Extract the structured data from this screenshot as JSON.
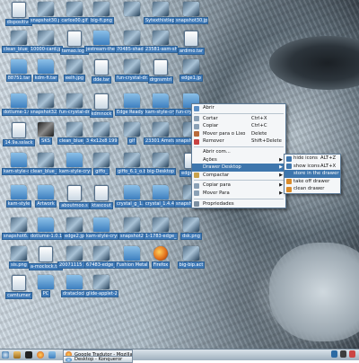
{
  "colors": {
    "selection": "#3e76ad",
    "icon_label_bg": "#3f7ab8",
    "menu_bg": "#f4f6f8"
  },
  "desktop_icons": [
    {
      "label": "dispositivo",
      "kind": "doc"
    },
    {
      "label": "snapshot30.png",
      "kind": "img"
    },
    {
      "label": "carlos00.gif",
      "kind": "img"
    },
    {
      "label": "big-fi.png",
      "kind": "img"
    },
    {
      "label": "",
      "kind": "img"
    },
    {
      "label": "Sytexthistlepor",
      "kind": "img"
    },
    {
      "label": "snapshot30.jpg",
      "kind": "img"
    },
    {
      "label": "clean_blue_1024x768",
      "kind": "img"
    },
    {
      "label": "10000-card.jpg",
      "kind": "img"
    },
    {
      "label": "tamao.log4",
      "kind": "doc"
    },
    {
      "label": "jestream-theme.tar",
      "kind": "folder"
    },
    {
      "label": "70485-shadow.jpg",
      "kind": "img"
    },
    {
      "label": "23581-asm-shadow.jpg",
      "kind": "img"
    },
    {
      "label": "ardimo.tar",
      "kind": "doc"
    },
    {
      "label": "88751.tar",
      "kind": "folder"
    },
    {
      "label": "kdm-fi.tar",
      "kind": "folder"
    },
    {
      "label": "eelh.jpg",
      "kind": "img"
    },
    {
      "label": "dde.tar",
      "kind": "doc"
    },
    {
      "label": "fun-crystal-dr.png",
      "kind": "img"
    },
    {
      "label": "drgnsmtrl",
      "kind": "doc"
    },
    {
      "label": "edge1.jp",
      "kind": "img"
    },
    {
      "label": "dotlume-1.0.1",
      "kind": "folder"
    },
    {
      "label": "snapshot32.png",
      "kind": "img"
    },
    {
      "label": "fun-crystal-dr.png",
      "kind": "img"
    },
    {
      "label": "kdmnock",
      "kind": "doc"
    },
    {
      "label": "Edge Ready Hu-tar",
      "kind": "folder"
    },
    {
      "label": "kam-style-crystal-1.0",
      "kind": "folder"
    },
    {
      "label": "fun-crystal-fa.tar",
      "kind": "folder"
    },
    {
      "label": "14.9a.sslack",
      "kind": "doc"
    },
    {
      "label": "SKS",
      "kind": "cat"
    },
    {
      "label": "clean_blue_1024x768",
      "kind": "img"
    },
    {
      "label": "3 4x12x8 1993",
      "kind": "img"
    },
    {
      "label": "gif",
      "kind": "img"
    },
    {
      "label": "23301 Amstudio",
      "kind": "img"
    },
    {
      "label": "snapshot36.png",
      "kind": "img"
    },
    {
      "label": "kam-style-crystal-1.4",
      "kind": "folder"
    },
    {
      "label": "clean_blue_1024x768",
      "kind": "img"
    },
    {
      "label": "kam-style-crystal-1.0",
      "kind": "folder"
    },
    {
      "label": "giffo_",
      "kind": "img"
    },
    {
      "label": "giffo_6.1_o.b",
      "kind": "img"
    },
    {
      "label": "big-Desktop",
      "kind": "img"
    },
    {
      "label": "edge.log",
      "kind": "doc"
    },
    {
      "label": "kam-style",
      "kind": "folder"
    },
    {
      "label": "Artwork",
      "kind": "folder"
    },
    {
      "label": "aboutmoo.s",
      "kind": "doc"
    },
    {
      "label": "ktascout",
      "kind": "doc"
    },
    {
      "label": "crystal_g_1.0.1.tar",
      "kind": "folder"
    },
    {
      "label": "crystal_1.4.4-dock",
      "kind": "folder"
    },
    {
      "label": "snapshot33.png",
      "kind": "img"
    },
    {
      "label": "snapshot6.png",
      "kind": "img"
    },
    {
      "label": "dotlume-1.0.1dz",
      "kind": "folder"
    },
    {
      "label": "edge2.jp",
      "kind": "img"
    },
    {
      "label": "kam-style-crystal-1.4",
      "kind": "folder"
    },
    {
      "label": "snapshot2",
      "kind": "img"
    },
    {
      "label": "1-1783-edge_la",
      "kind": "img"
    },
    {
      "label": "dsk.png",
      "kind": "img"
    },
    {
      "label": "sis.png",
      "kind": "img"
    },
    {
      "label": "a-moclock.tar",
      "kind": "doc"
    },
    {
      "label": "20071115 16.0.png",
      "kind": "img"
    },
    {
      "label": "67483-edge_tar",
      "kind": "img"
    },
    {
      "label": "Fushion Metal 1.4",
      "kind": "folder"
    },
    {
      "label": "Firefox",
      "kind": "web"
    },
    {
      "label": "big-bip.act",
      "kind": "img"
    },
    {
      "label": "camtumer",
      "kind": "doc"
    },
    {
      "label": "PC",
      "kind": "folder"
    },
    {
      "label": "drataclock",
      "kind": "folder"
    },
    {
      "label": "glide-applet-2.0",
      "kind": "img"
    }
  ],
  "context_menu": {
    "items": [
      {
        "label": "Abrir",
        "shortcut": ""
      },
      {
        "sep": true
      },
      {
        "label": "Cortar",
        "shortcut": "Ctrl+X"
      },
      {
        "label": "Copiar",
        "shortcut": "Ctrl+C"
      },
      {
        "label": "Mover para o Lixo",
        "shortcut": "Delete"
      },
      {
        "label": "Remover",
        "shortcut": "Shift+Delete"
      },
      {
        "sep": true
      },
      {
        "label": "Abrir com...",
        "shortcut": ""
      },
      {
        "label": "Ações",
        "shortcut": "",
        "submenu": true
      },
      {
        "label": "Drawer Desktop",
        "shortcut": "",
        "submenu": true,
        "highlight": true
      },
      {
        "label": "Compactar",
        "shortcut": "",
        "submenu": true
      },
      {
        "sep": true
      },
      {
        "label": "Copiar para",
        "shortcut": "",
        "submenu": true
      },
      {
        "label": "Mover Para",
        "shortcut": "",
        "submenu": true
      },
      {
        "sep": true
      },
      {
        "label": "Propriedades",
        "shortcut": ""
      }
    ]
  },
  "submenu": {
    "items": [
      {
        "label": "hide icons",
        "shortcut": "ALT+Z"
      },
      {
        "label": "show icons",
        "shortcut": "ALT+X"
      },
      {
        "label": "store in the drawer",
        "shortcut": "",
        "highlight": true
      },
      {
        "label": "take off drawer",
        "shortcut": ""
      },
      {
        "label": "clean drawer",
        "shortcut": ""
      }
    ]
  },
  "taskbar": {
    "tasks": [
      {
        "label": "Google Tradutor - Mozilla"
      },
      {
        "label": "Desktop - Konqueror"
      }
    ]
  }
}
